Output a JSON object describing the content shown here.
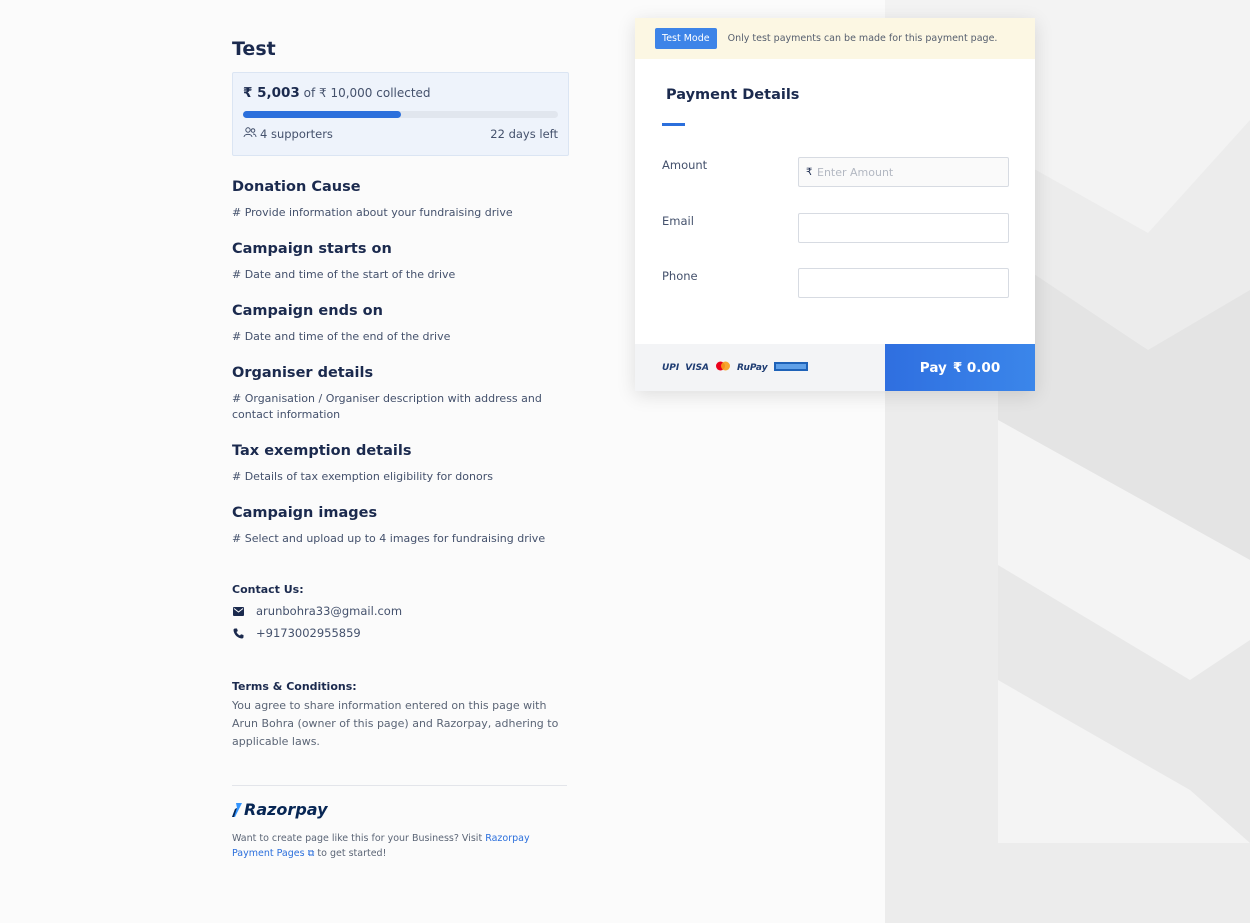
{
  "campaign": {
    "title": "Test",
    "collected_amount": "₹ 5,003",
    "goal_text": "of ₹ 10,000 collected",
    "progress_fraction": 0.5003,
    "supporters": "4 supporters",
    "days_left": "22 days left"
  },
  "sections": [
    {
      "heading": "Donation Cause",
      "text": "# Provide information about your fundraising drive"
    },
    {
      "heading": "Campaign starts on",
      "text": "# Date and time of the start of the drive"
    },
    {
      "heading": "Campaign ends on",
      "text": "# Date and time of the end of the drive"
    },
    {
      "heading": "Organiser details",
      "text": "# Organisation / Organiser description with address and contact information"
    },
    {
      "heading": "Tax exemption details",
      "text": "# Details of tax exemption eligibility for donors"
    },
    {
      "heading": "Campaign images",
      "text": "# Select and upload up to 4 images for fundraising drive"
    }
  ],
  "contact": {
    "heading": "Contact Us:",
    "email": "arunbohra33@gmail.com",
    "phone": "+9173002955859"
  },
  "terms": {
    "heading": "Terms & Conditions:",
    "text": "You agree to share information entered on this page with Arun Bohra (owner of this page) and Razorpay, adhering to applicable laws."
  },
  "footer": {
    "logo_text": "Razorpay",
    "note_prefix": "Want to create page like this for your Business? Visit ",
    "link_text": "Razorpay Payment Pages",
    "note_suffix": " to get started!"
  },
  "payment": {
    "badge": "Test Mode",
    "banner_text": "Only test payments can be made for this payment page.",
    "title": "Payment Details",
    "amount_label": "Amount",
    "amount_placeholder": "Enter Amount",
    "rupee_symbol": "₹",
    "email_label": "Email",
    "phone_label": "Phone",
    "methods": [
      "UPI",
      "VISA",
      "RuPay"
    ],
    "pay_label": "Pay",
    "pay_amount": "₹ 0.00"
  },
  "colors": {
    "accent": "#2b6fdc",
    "heading": "#1b2a4e"
  }
}
